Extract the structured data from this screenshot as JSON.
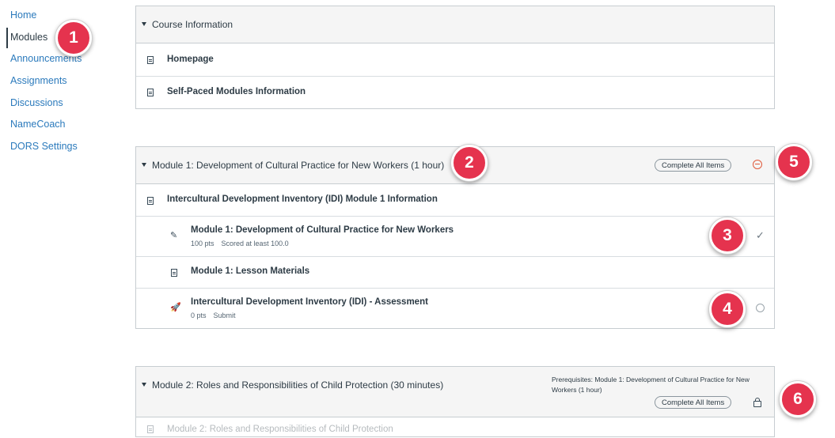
{
  "sidebar": {
    "items": [
      {
        "label": "Home"
      },
      {
        "label": "Modules"
      },
      {
        "label": "Announcements"
      },
      {
        "label": "Assignments"
      },
      {
        "label": "Discussions"
      },
      {
        "label": "NameCoach"
      },
      {
        "label": "DORS Settings"
      }
    ]
  },
  "modules": [
    {
      "title": "Course Information",
      "items": [
        {
          "title": "Homepage"
        },
        {
          "title": "Self-Paced Modules Information"
        }
      ]
    },
    {
      "title": "Module 1: Development of Cultural Practice for New Workers (1 hour)",
      "complete_all_label": "Complete All Items",
      "items": [
        {
          "title": "Intercultural Development Inventory (IDI) Module 1 Information"
        },
        {
          "title": "Module 1: Development of Cultural Practice for New Workers",
          "points": "100 pts",
          "requirement": "Scored at least 100.0"
        },
        {
          "title": "Module 1: Lesson Materials"
        },
        {
          "title": "Intercultural Development Inventory (IDI) - Assessment",
          "points": "0 pts",
          "requirement": "Submit"
        }
      ]
    },
    {
      "title": "Module 2: Roles and Responsibilities of Child Protection (30 minutes)",
      "prerequisites": "Prerequisites: Module 1: Development of Cultural Practice for New Workers (1 hour)",
      "complete_all_label": "Complete All Items",
      "items": [
        {
          "title": "Module 2: Roles and Responsibilities of Child Protection"
        }
      ]
    }
  ],
  "callouts": [
    "1",
    "2",
    "3",
    "4",
    "5",
    "6"
  ],
  "colors": {
    "callout": "#e5334e",
    "link": "#2b7abc",
    "warning": "#e05a3b"
  }
}
